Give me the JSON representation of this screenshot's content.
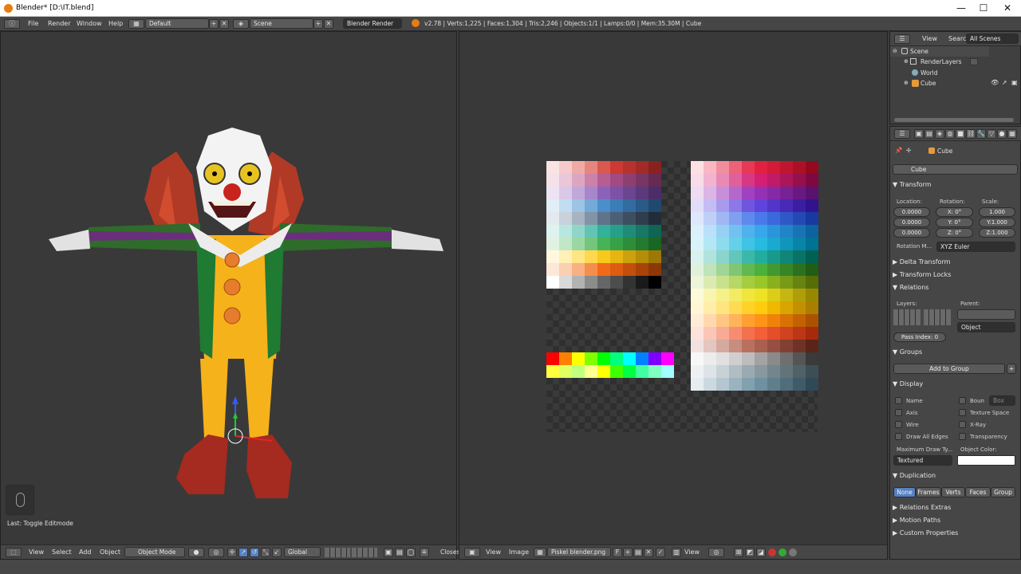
{
  "window": {
    "title": "Blender* [D:\\IT.blend]",
    "min": "—",
    "max": "☐",
    "close": "✕"
  },
  "info": {
    "menus": [
      "File",
      "Render",
      "Window",
      "Help"
    ],
    "layout": "Default",
    "scene": "Scene",
    "engine": "Blender Render",
    "stats": "v2.78 | Verts:1,225 | Faces:1,304 | Tris:2,246 | Objects:1/1 | Lamps:0/0 | Mem:35.30M | Cube"
  },
  "viewport3d": {
    "last_op": "Last: Toggle Editmode",
    "menus": [
      "View",
      "Select",
      "Add",
      "Object"
    ],
    "mode": "Object Mode",
    "orientation": "Global",
    "close_label": "Closes"
  },
  "image_editor": {
    "menus": [
      "View",
      "Image"
    ],
    "image_name": "Piskel blender.png",
    "f_label": "F",
    "view_label": "View"
  },
  "outliner": {
    "menus": [
      "View",
      "Search"
    ],
    "filter": "All Scenes",
    "items": [
      "Scene",
      "RenderLayers",
      "World",
      "Cube"
    ]
  },
  "properties": {
    "object_path": "Cube",
    "object_name": "Cube",
    "transform": {
      "header": "Transform",
      "location_label": "Location:",
      "rotation_label": "Rotation:",
      "scale_label": "Scale:",
      "location": [
        "0.0000",
        "0.0000",
        "0.0000"
      ],
      "rotation": [
        "X:",
        "Y:",
        "Z:"
      ],
      "rotation_values": [
        "0°",
        "0°",
        "0°"
      ],
      "scale": [
        "1.000",
        "Y:1.000",
        "Z:1.000"
      ],
      "rotation_mode_label": "Rotation M...",
      "rotation_mode": "XYZ Euler"
    },
    "collapsed": [
      "Delta Transform",
      "Transform Locks"
    ],
    "relations": {
      "header": "Relations",
      "layers_label": "Layers:",
      "parent_label": "Parent:",
      "parent_type": "Object",
      "pass_index": "Pass Index:",
      "pass_value": "0"
    },
    "groups": {
      "header": "Groups",
      "add": "Add to Group"
    },
    "display": {
      "header": "Display",
      "left": [
        "Name",
        "Axis",
        "Wire",
        "Draw All Edges"
      ],
      "right": [
        "Boun",
        "Texture Space",
        "X-Ray",
        "Transparency"
      ],
      "bound_type": "Box",
      "max_draw_label": "Maximum Draw Ty...",
      "max_draw": "Textured",
      "obj_color_label": "Object Color:"
    },
    "duplication": {
      "header": "Duplication",
      "options": [
        "None",
        "Frames",
        "Verts",
        "Faces",
        "Group"
      ]
    },
    "bottom_panels": [
      "Relations Extras",
      "Motion Paths",
      "Custom Properties"
    ]
  },
  "colors": {
    "accent": "#5680c2",
    "bg": "#393939"
  },
  "palette_left": [
    [
      "#fbe3e3",
      "#f6caca",
      "#efaaa6",
      "#e6857f",
      "#d9584f",
      "#cc3a33",
      "#b8322d",
      "#a02b27",
      "#88221f"
    ],
    [
      "#f5e1ea",
      "#eac6d7",
      "#dca6c2",
      "#ca81aa",
      "#b65d92",
      "#a24a82",
      "#8d3f72",
      "#793563",
      "#652b54"
    ],
    [
      "#ece3f3",
      "#d9c8e7",
      "#c2a8da",
      "#a786cb",
      "#8b62b9",
      "#7b52a6",
      "#6b4591",
      "#5b397c",
      "#4b2e67"
    ],
    [
      "#e1eef8",
      "#c2dcf0",
      "#9dc4e5",
      "#74aad8",
      "#4a8fcb",
      "#3b7db7",
      "#326ba0",
      "#2a5a88",
      "#214970"
    ],
    [
      "#e3e9ee",
      "#c8d2db",
      "#a6b4c1",
      "#8294a5",
      "#5f7489",
      "#4c6075",
      "#3d4e60",
      "#2f3d4c",
      "#212c38"
    ],
    [
      "#dcf3ef",
      "#b9e6de",
      "#8fd6c9",
      "#62c4b2",
      "#33b19a",
      "#27a089",
      "#1f8c77",
      "#177865",
      "#106453"
    ],
    [
      "#e0f3e3",
      "#c1e7c6",
      "#9bd7a3",
      "#72c67e",
      "#46b356",
      "#37a147",
      "#2d8d3b",
      "#237a30",
      "#196625"
    ],
    [
      "#fff8dc",
      "#fff0b5",
      "#ffe583",
      "#ffd84f",
      "#f8c81d",
      "#e6b512",
      "#cda10d",
      "#b58d08",
      "#9c7904"
    ],
    [
      "#fde7d8",
      "#fbcfb1",
      "#f8b182",
      "#f58e4c",
      "#f06a18",
      "#dd5c10",
      "#c24f0c",
      "#a84309",
      "#8e3706"
    ],
    [
      "#ffffff",
      "#d9d9d9",
      "#b3b3b3",
      "#8c8c8c",
      "#666666",
      "#4d4d4d",
      "#333333",
      "#1a1a1a",
      "#000000"
    ]
  ],
  "palette_strip": [
    [
      "#ff0000",
      "#ff8000",
      "#ffff00",
      "#80ff00",
      "#00ff00",
      "#00ff80",
      "#00ffff",
      "#0080ff",
      "#8000ff",
      "#ff00ff"
    ],
    [
      "#ffff40",
      "#e0ff60",
      "#c0ff80",
      "#ffff90",
      "#ffff00",
      "#40ff00",
      "#00ff40",
      "#40ffa0",
      "#80ffc0",
      "#a0ffff"
    ]
  ],
  "palette_right": [
    [
      "#fde0e4",
      "#f8b7c1",
      "#f28d9d",
      "#ec6279",
      "#e63956",
      "#e2203f",
      "#d31b37",
      "#bf162f",
      "#aa1127",
      "#94091e"
    ],
    [
      "#f9dcea",
      "#f1b3d0",
      "#e989b6",
      "#e0609c",
      "#d83783",
      "#d41f73",
      "#c11a67",
      "#ab155a",
      "#95104d",
      "#7f0840"
    ],
    [
      "#eedcf3",
      "#dbb5e6",
      "#c78ed9",
      "#b468cc",
      "#a042bf",
      "#9531b5",
      "#8629a6",
      "#772294",
      "#681a82",
      "#591270"
    ],
    [
      "#e2defa",
      "#c5bcf3",
      "#a89aed",
      "#8c78e6",
      "#6f56df",
      "#5f44db",
      "#5336c9",
      "#482ab6",
      "#3c1ea3",
      "#31128f"
    ],
    [
      "#dfe7fc",
      "#bfd0f8",
      "#9fb8f4",
      "#7fa0f0",
      "#5f89ec",
      "#4a7ae9",
      "#3b68da",
      "#2f58c7",
      "#2349b4",
      "#1839a0"
    ],
    [
      "#dcf0fc",
      "#b9e1f9",
      "#96d1f5",
      "#72c1f1",
      "#4fb1ed",
      "#38a6eb",
      "#2b95dc",
      "#2183c8",
      "#1773b4",
      "#0d62a0"
    ],
    [
      "#d9f3fa",
      "#b3e7f4",
      "#8ddbef",
      "#66cfe9",
      "#40c3e4",
      "#27bbe0",
      "#1aa9cf",
      "#1196bb",
      "#0884a7",
      "#007293"
    ],
    [
      "#d8f1ee",
      "#b1e3dd",
      "#89d4cc",
      "#62c6bb",
      "#3bb8aa",
      "#21ae9f",
      "#17998b",
      "#0f8678",
      "#087366",
      "#006054"
    ],
    [
      "#dff1dc",
      "#c0e3b9",
      "#a0d596",
      "#80c774",
      "#60b951",
      "#4cb03c",
      "#41992f",
      "#378526",
      "#2c711d",
      "#215d14"
    ],
    [
      "#edf5d9",
      "#dbebb3",
      "#c9e18d",
      "#b7d767",
      "#a5cd41",
      "#99c72a",
      "#88b01f",
      "#779a17",
      "#66840f",
      "#556e07"
    ],
    [
      "#fcfad8",
      "#f9f5b1",
      "#f6f08a",
      "#f3eb63",
      "#f0e63c",
      "#eee224",
      "#dccd19",
      "#c5b611",
      "#ae9f09",
      "#978801"
    ],
    [
      "#fff6d4",
      "#ffedaa",
      "#ffe47f",
      "#ffdb55",
      "#ffd22a",
      "#ffcc10",
      "#f0b900",
      "#d9a500",
      "#c29100",
      "#ab7d00"
    ],
    [
      "#ffecd6",
      "#ffd9ad",
      "#ffc683",
      "#ffb35a",
      "#ffa031",
      "#ff9418",
      "#f0820b",
      "#d97205",
      "#c26202",
      "#ab5200"
    ],
    [
      "#fde3dc",
      "#fbc6b8",
      "#f8aa95",
      "#f68d71",
      "#f3714e",
      "#f25f38",
      "#e34f29",
      "#cf431f",
      "#bb3715",
      "#a72b0b"
    ],
    [
      "#f1e2df",
      "#e3c6bf",
      "#d5a99f",
      "#c78d7f",
      "#b9705f",
      "#a9604f",
      "#964f41",
      "#824033",
      "#6e3226",
      "#5a2419"
    ],
    [
      "#f7f7f7",
      "#ececec",
      "#e0e0e0",
      "#cfcfcf",
      "#bdbdbd",
      "#a3a3a3",
      "#8a8a8a",
      "#6f6f6f",
      "#555555",
      "#3a3a3a"
    ],
    [
      "#eef1f2",
      "#dde3e6",
      "#c8d1d6",
      "#b1bdc3",
      "#9aaab1",
      "#87989f",
      "#74868d",
      "#62737a",
      "#506168",
      "#3e4e55"
    ],
    [
      "#e6edf0",
      "#cdd9e0",
      "#b4c6cf",
      "#9bb3bf",
      "#82a0ae",
      "#6f919f",
      "#5f7f8d",
      "#4f6d7b",
      "#3f5b69",
      "#2f4957"
    ]
  ]
}
